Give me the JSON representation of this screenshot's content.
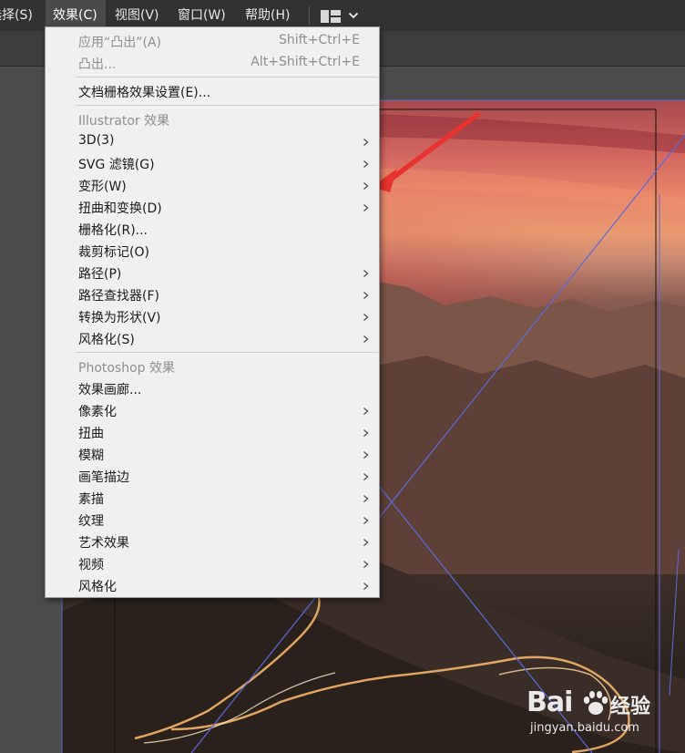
{
  "menubar": {
    "items": [
      {
        "label": "选择(S)",
        "active": false
      },
      {
        "label": "效果(C)",
        "active": true
      },
      {
        "label": "视图(V)",
        "active": false
      },
      {
        "label": "窗口(W)",
        "active": false
      },
      {
        "label": "帮助(H)",
        "active": false
      }
    ],
    "layout_icon": "workspace-layout-icon",
    "dropdown_icon": "chevron-down-icon"
  },
  "effect_menu": {
    "apply_last": {
      "label": "应用“凸出”(A)",
      "shortcut": "Shift+Ctrl+E"
    },
    "last_effect": {
      "label": "凸出...",
      "shortcut": "Alt+Shift+Ctrl+E"
    },
    "document_raster": {
      "label": "文档栅格效果设置(E)..."
    },
    "illustrator_header": "Illustrator 效果",
    "illustrator_items": [
      {
        "label": "3D(3)",
        "submenu": true
      },
      {
        "label": "SVG 滤镜(G)",
        "submenu": true
      },
      {
        "label": "变形(W)",
        "submenu": true
      },
      {
        "label": "扭曲和变换(D)",
        "submenu": true
      },
      {
        "label": "栅格化(R)...",
        "submenu": false
      },
      {
        "label": "裁剪标记(O)",
        "submenu": false
      },
      {
        "label": "路径(P)",
        "submenu": true
      },
      {
        "label": "路径查找器(F)",
        "submenu": true
      },
      {
        "label": "转换为形状(V)",
        "submenu": true
      },
      {
        "label": "风格化(S)",
        "submenu": true
      }
    ],
    "photoshop_header": "Photoshop 效果",
    "photoshop_items": [
      {
        "label": "效果画廊...",
        "submenu": false
      },
      {
        "label": "像素化",
        "submenu": true
      },
      {
        "label": "扭曲",
        "submenu": true
      },
      {
        "label": "模糊",
        "submenu": true
      },
      {
        "label": "画笔描边",
        "submenu": true
      },
      {
        "label": "素描",
        "submenu": true
      },
      {
        "label": "纹理",
        "submenu": true
      },
      {
        "label": "艺术效果",
        "submenu": true
      },
      {
        "label": "视频",
        "submenu": true
      },
      {
        "label": "风格化",
        "submenu": true
      }
    ]
  },
  "watermark": {
    "logo_text": "Bai",
    "logo_cn": "经验",
    "url": "jingyan.baidu.com"
  },
  "colors": {
    "menubar_bg": "#323232",
    "menu_bg": "#f0f0f0",
    "annotation_arrow": "#e8322e",
    "guide_line": "#5b6bdc"
  }
}
